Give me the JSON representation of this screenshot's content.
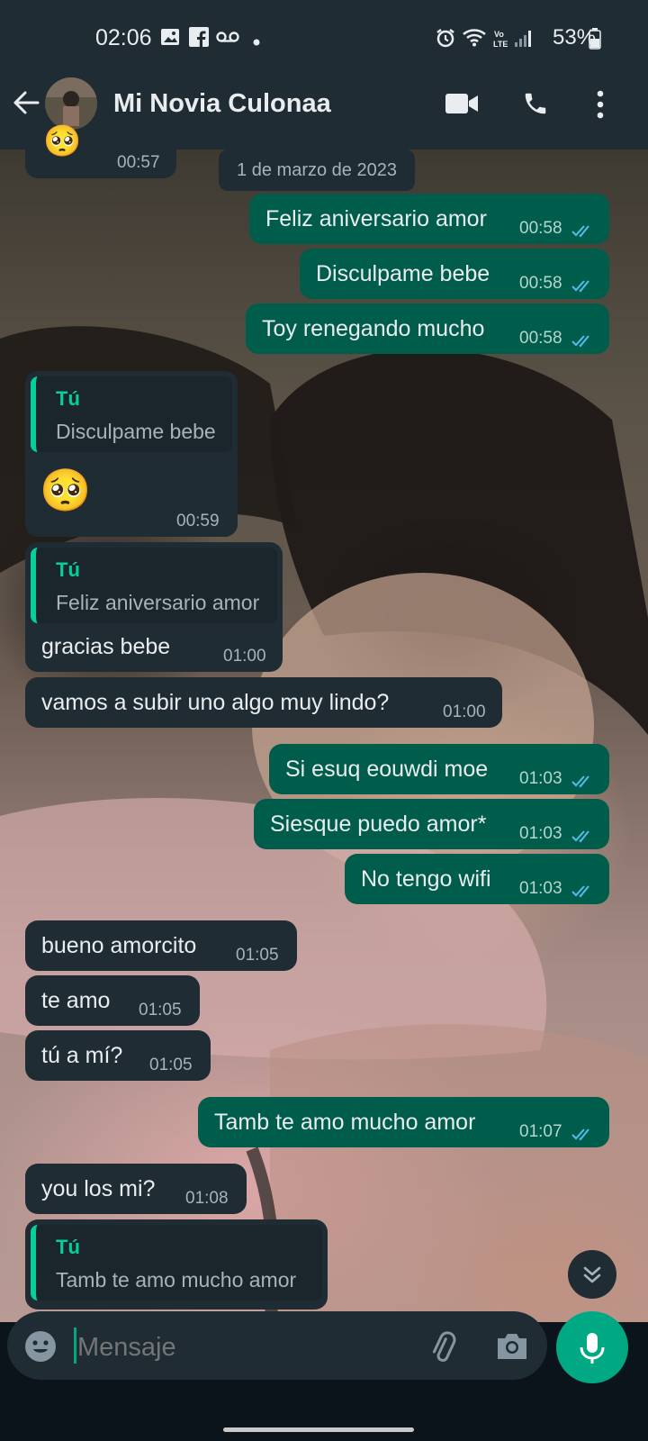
{
  "status_bar": {
    "time": "02:06",
    "battery": "53%",
    "icons": [
      "image-notification-icon",
      "facebook-icon",
      "voicemail-icon",
      "dot-icon",
      "alarm-icon",
      "wifi-icon",
      "volte-icon",
      "signal-icon",
      "battery-icon"
    ]
  },
  "header": {
    "title": "Mi Novia Culonaa",
    "actions": [
      "back-arrow-icon",
      "video-call-icon",
      "voice-call-icon",
      "more-options-icon"
    ]
  },
  "date_separator": "1 de marzo de 2023",
  "messages": {
    "m0": {
      "time": "00:57"
    },
    "m1": {
      "text": "Feliz aniversario amor",
      "time": "00:58"
    },
    "m2": {
      "text": "Disculpame bebe",
      "time": "00:58"
    },
    "m3": {
      "text": "Toy renegando mucho",
      "time": "00:58"
    },
    "m4": {
      "quote_author": "Tú",
      "quote_text": "Disculpame bebe",
      "text": "🥺",
      "time": "00:59"
    },
    "m5": {
      "quote_author": "Tú",
      "quote_text": "Feliz aniversario amor",
      "text": "gracias bebe",
      "time": "01:00"
    },
    "m6": {
      "text": "vamos a subir uno algo muy lindo?",
      "time": "01:00"
    },
    "m7": {
      "text": "Si esuq eouwdi moe",
      "time": "01:03"
    },
    "m8": {
      "text": "Siesque puedo amor*",
      "time": "01:03"
    },
    "m9": {
      "text": "No tengo wifi",
      "time": "01:03"
    },
    "m10": {
      "text": "bueno amorcito",
      "time": "01:05"
    },
    "m11": {
      "text": "te amo",
      "time": "01:05"
    },
    "m12": {
      "text": "tú a mí?",
      "time": "01:05"
    },
    "m13": {
      "text": "Tamb te amo mucho amor",
      "time": "01:07"
    },
    "m14": {
      "text": "you los mi?",
      "time": "01:08"
    },
    "m15": {
      "quote_author": "Tú",
      "quote_text": "Tamb te amo mucho amor"
    }
  },
  "composer": {
    "placeholder": "Mensaje",
    "icons": [
      "emoji-icon",
      "attach-icon",
      "camera-icon",
      "mic-icon"
    ]
  },
  "colors": {
    "outgoing_bubble": "#005c4b",
    "incoming_bubble": "#1f2c34",
    "accent": "#00a884",
    "read_ticks": "#53bdeb",
    "header": "#1f2c34"
  }
}
